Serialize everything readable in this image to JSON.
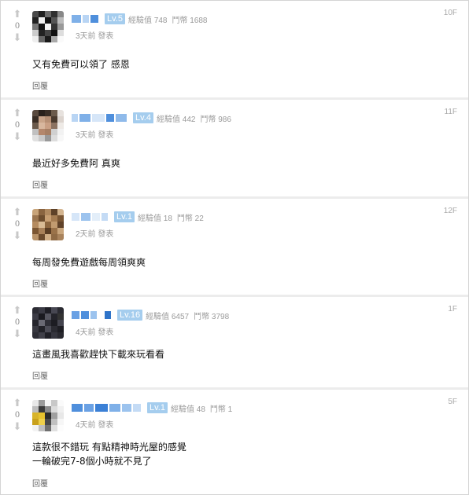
{
  "labels": {
    "exp": "經驗值",
    "coins": "鬥幣",
    "posted_suffix": "發表",
    "reply": "回覆",
    "up_icon": "up-arrow-icon",
    "down_icon": "down-arrow-icon"
  },
  "comments": [
    {
      "votes": "0",
      "level": "Lv.5",
      "exp": "經驗值 748",
      "coins": "鬥幣 1688",
      "time": "3天前 發表",
      "floor": "10F",
      "content": [
        "又有免費可以領了 感恩"
      ],
      "reply": "回覆"
    },
    {
      "votes": "0",
      "level": "Lv.4",
      "exp": "經驗值 442",
      "coins": "鬥幣 986",
      "time": "3天前 發表",
      "floor": "11F",
      "content": [
        "最近好多免費阿 真爽"
      ],
      "reply": "回覆"
    },
    {
      "votes": "0",
      "level": "Lv.1",
      "exp": "經驗值 18",
      "coins": "鬥幣 22",
      "time": "2天前 發表",
      "floor": "12F",
      "content": [
        "每周發免費遊戲每周領爽爽"
      ],
      "reply": "回覆"
    },
    {
      "votes": "0",
      "level": "Lv.16",
      "exp": "經驗值 6457",
      "coins": "鬥幣 3798",
      "time": "4天前 發表",
      "floor": "1F",
      "content": [
        "這畫風我喜歡趕快下載來玩看看"
      ],
      "reply": "回覆"
    },
    {
      "votes": "0",
      "level": "Lv.1",
      "exp": "經驗值 48",
      "coins": "鬥幣 1",
      "time": "4天前 發表",
      "floor": "5F",
      "content": [
        "這款很不錯玩 有點精神時光屋的感覺",
        "一輪破完7-8個小時就不見了"
      ],
      "reply": "回覆"
    }
  ],
  "colors": {
    "level_badge": "#a5cdee",
    "divider": "#ececec",
    "meta_text": "#9a9a9a"
  }
}
